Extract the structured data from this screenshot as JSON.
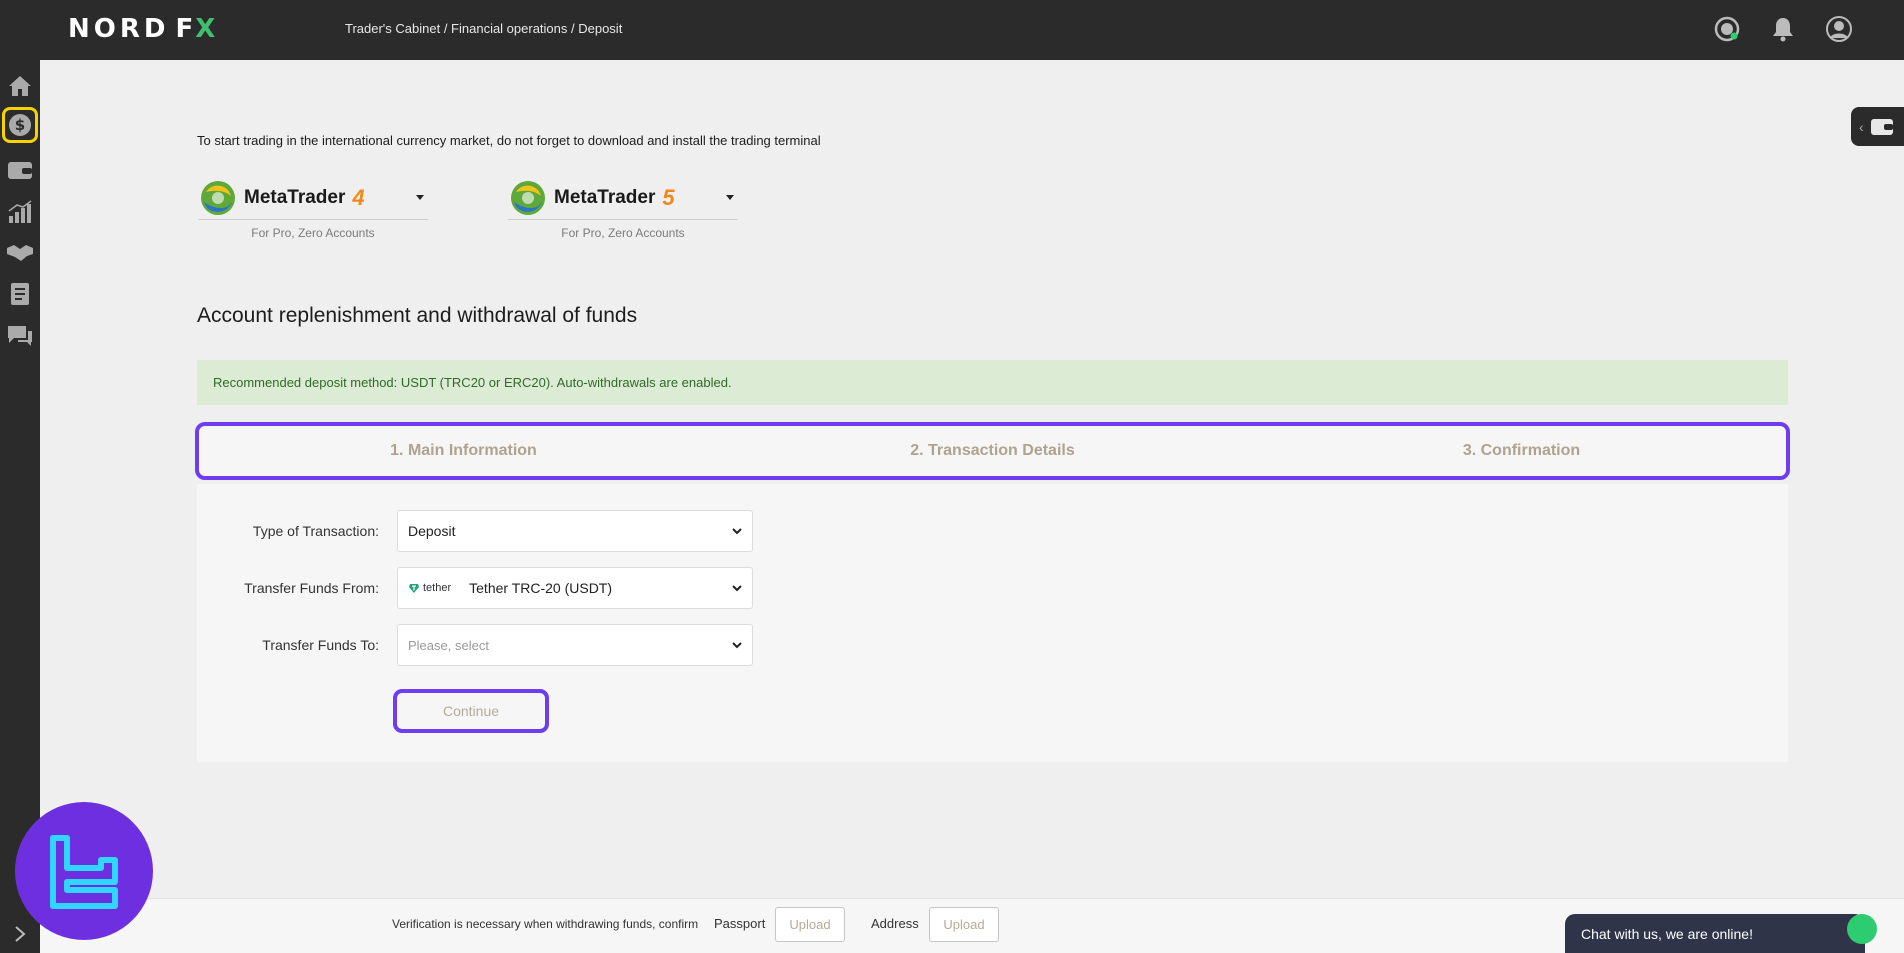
{
  "header": {
    "logo_text": "NORD",
    "logo_fx_f": "F",
    "logo_fx_x": "X",
    "breadcrumb": "Trader's Cabinet / Financial operations / Deposit"
  },
  "sidebar": {
    "items": [
      {
        "icon": "home-icon"
      },
      {
        "icon": "dollar-icon",
        "active": true
      },
      {
        "icon": "wallet-icon"
      },
      {
        "icon": "chart-icon"
      },
      {
        "icon": "handshake-icon"
      },
      {
        "icon": "document-icon"
      },
      {
        "icon": "chat-icon"
      }
    ]
  },
  "intro_text": "To start trading in the international currency market, do not forget to download and install the trading terminal",
  "terminals": [
    {
      "name": "MetaTrader",
      "number": "4",
      "subtitle": "For Pro, Zero Accounts"
    },
    {
      "name": "MetaTrader",
      "number": "5",
      "subtitle": "For Pro, Zero Accounts"
    }
  ],
  "section_title": "Account replenishment and withdrawal of funds",
  "alert_text": "Recommended deposit method: USDT (TRC20 or ERC20). Auto-withdrawals are enabled.",
  "steps": [
    "1. Main Information",
    "2. Transaction Details",
    "3. Confirmation"
  ],
  "form": {
    "type_label": "Type of Transaction:",
    "type_value": "Deposit",
    "from_label": "Transfer Funds From:",
    "from_badge": "tether",
    "from_value": "Tether TRC-20 (USDT)",
    "to_label": "Transfer Funds To:",
    "to_placeholder": "Please, select",
    "continue_label": "Continue"
  },
  "verification": {
    "text": "Verification is necessary when withdrawing funds, confirm",
    "passport_label": "Passport",
    "passport_upload": "Upload",
    "address_label": "Address",
    "address_upload": "Upload"
  },
  "chat": {
    "label": "Chat with us, we are online!"
  },
  "colors": {
    "accent": "#6e3df0",
    "header_bg": "#2b2b2b",
    "alert_bg": "#dcebd3",
    "active_sidebar_border": "#f7d200"
  }
}
